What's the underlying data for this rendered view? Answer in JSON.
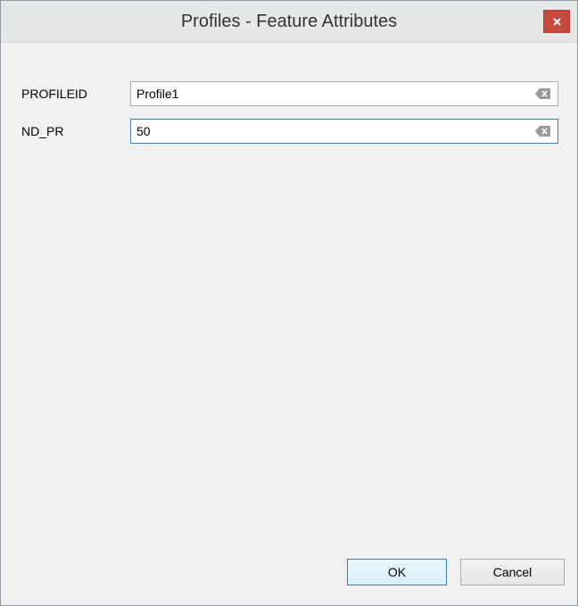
{
  "window": {
    "title": "Profiles - Feature Attributes"
  },
  "fields": [
    {
      "label": "PROFILEID",
      "value": "Profile1"
    },
    {
      "label": "ND_PR",
      "value": "50"
    }
  ],
  "buttons": {
    "ok_label": "OK",
    "cancel_label": "Cancel"
  },
  "icons": {
    "close": "close-icon",
    "clear": "clear-text-icon"
  },
  "colors": {
    "close_button": "#c74b3c",
    "focus_border": "#3c7fb1"
  }
}
